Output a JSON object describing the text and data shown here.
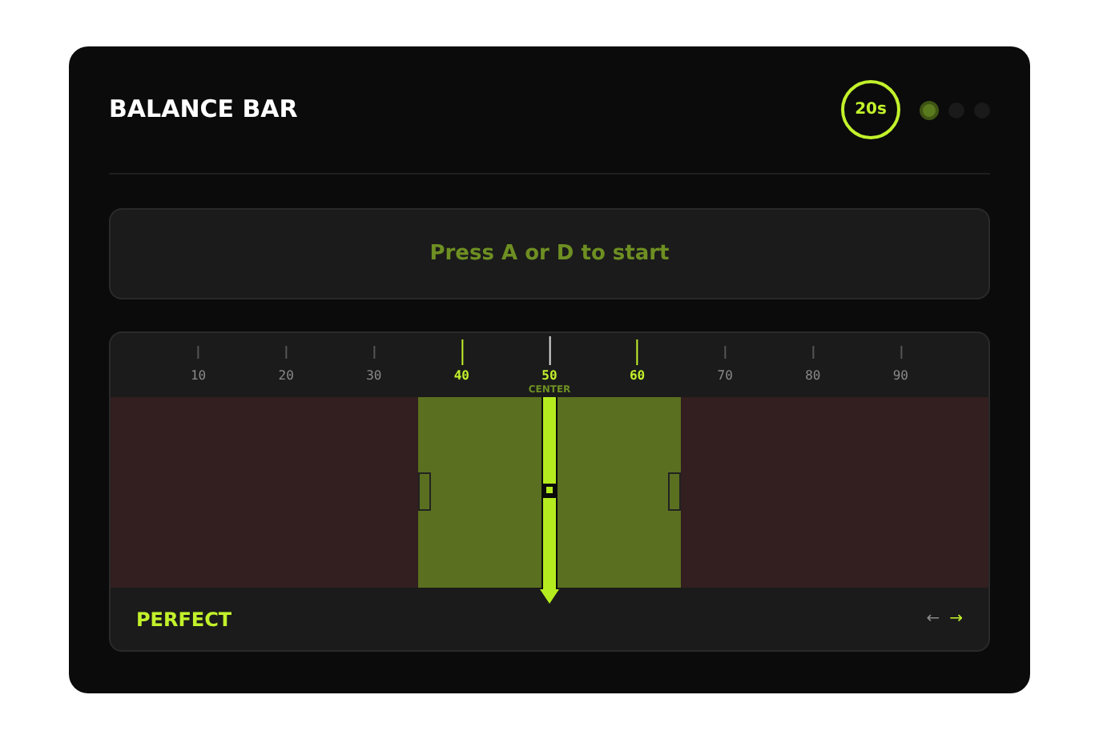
{
  "title": "BALANCE BAR",
  "timer": "20s",
  "rounds": [
    {
      "selected": true
    },
    {
      "selected": false
    },
    {
      "selected": false
    }
  ],
  "prompt": "Press A or D to start",
  "scale": [
    {
      "label": "10",
      "highlighted": false
    },
    {
      "label": "20",
      "highlighted": false
    },
    {
      "label": "30",
      "highlighted": false
    },
    {
      "label": "40",
      "highlighted": true
    },
    {
      "label": "50",
      "highlighted": true
    },
    {
      "label": "60",
      "highlighted": true
    },
    {
      "label": "70",
      "highlighted": false
    },
    {
      "label": "80",
      "highlighted": false
    },
    {
      "label": "90",
      "highlighted": false
    }
  ],
  "center_label": "CENTER",
  "needle": {
    "level": 0.5
  },
  "status": "PERFECT",
  "arrows": [
    {
      "label": "←",
      "selected": false
    },
    {
      "label": "→",
      "selected": true
    }
  ]
}
